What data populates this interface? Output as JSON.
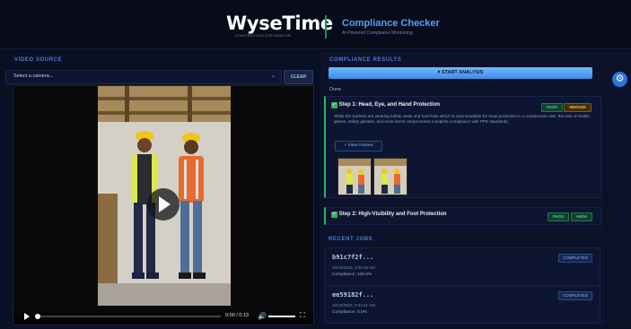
{
  "header": {
    "logo": "WyseTime",
    "logo_tagline": "CONSTRUCTION SITE MONITOR",
    "app_title": "Compliance Checker",
    "app_subtitle": "AI-Powered Compliance Monitoring"
  },
  "video_source": {
    "label": "VIDEO SOURCE",
    "select_placeholder": "Select a camera...",
    "clear_label": "CLEAR",
    "time": "0:00 / 0:13"
  },
  "compliance": {
    "label": "COMPLIANCE RESULTS",
    "start_label": "START ANALYSIS",
    "status": "Done",
    "steps": [
      {
        "title": "Step 1: Head, Eye, and Hand Protection",
        "result": "PASS",
        "severity": "MEDIUM",
        "description": "While the workers are wearing safety vests and hard hats which is commendable for head protection in a construction site, the lack of visible gloves, safety glasses, and more items compromises complete compliance with PPE standards.",
        "frames_label": "+ View Frames"
      },
      {
        "title": "Step 2: High-Visibility and Foot Protection",
        "result": "PASS",
        "severity": "HIGH"
      }
    ]
  },
  "recent_jobs": {
    "label": "RECENT JOBS",
    "items": [
      {
        "id": "b91c7f2f...",
        "date": "10/15/2023, 3:05:45 AM",
        "compliance": "Compliance: 100.0%",
        "status": "COMPLETED"
      },
      {
        "id": "ee59182f...",
        "date": "10/15/2023, 3:02:41 AM",
        "compliance": "Compliance: 0.0%",
        "status": "COMPLETED"
      }
    ]
  },
  "colors": {
    "accent": "#4fa3ff",
    "pass": "#2db36a",
    "medium": "#f1b93b",
    "background": "#0a1024"
  },
  "icons": {
    "settings": "gear-icon",
    "play": "play-icon",
    "volume": "volume-icon",
    "fullscreen": "fullscreen-icon",
    "check": "check-icon"
  }
}
